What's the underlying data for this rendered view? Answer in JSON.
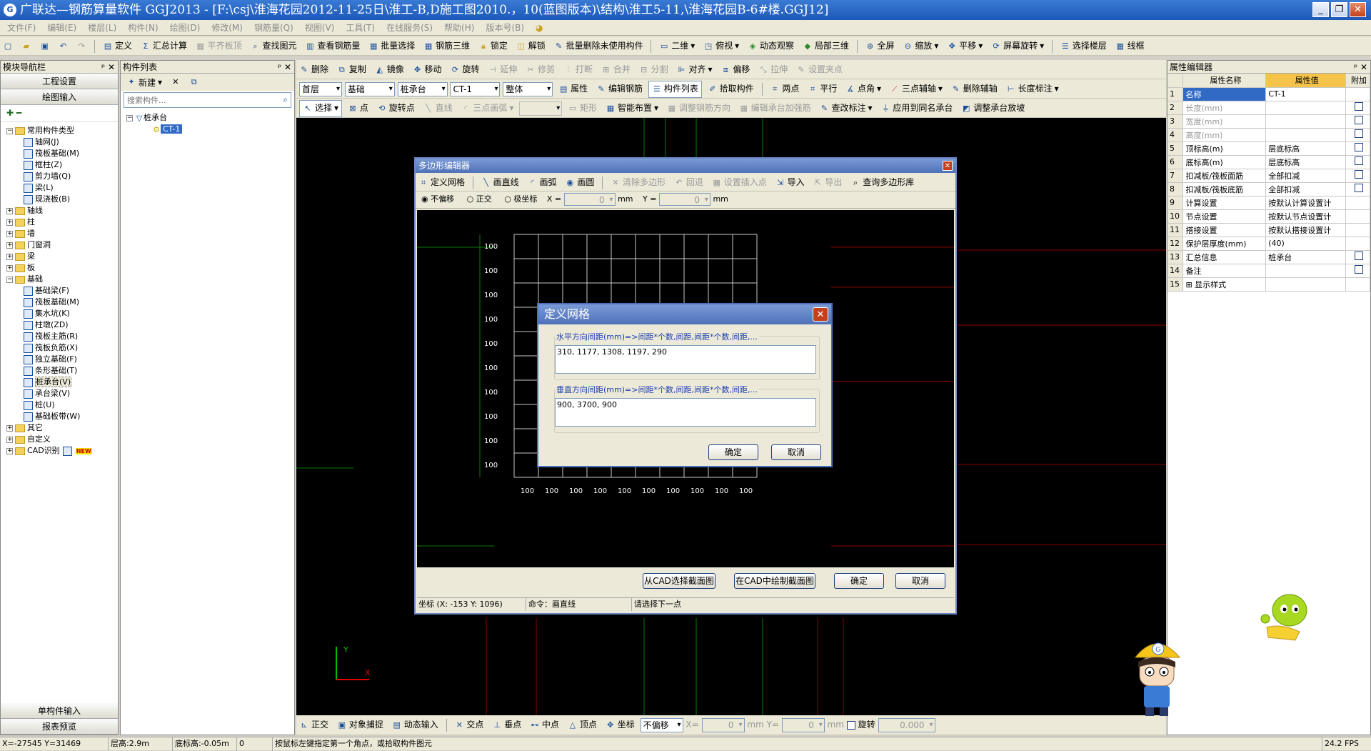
{
  "title": "广联达—钢筋算量软件 GGJ2013 - [F:\\csj\\淮海花园2012-11-25日\\淮工-B,D施工图2010.，10(蓝图版本)\\结构\\淮工5-11,\\淮海花园B-6#楼.GGJ12]",
  "menu": [
    "文件(F)",
    "编辑(E)",
    "楼层(L)",
    "构件(N)",
    "绘图(D)",
    "修改(M)",
    "钢筋量(Q)",
    "视图(V)",
    "工具(T)",
    "在线服务(S)",
    "帮助(H)",
    "版本号(B)"
  ],
  "toolbar1": {
    "define": "定义",
    "sum": "汇总计算",
    "flatten": "平齐板顶",
    "find": "查找图元",
    "view_rebar": "查看钢筋量",
    "batch_select": "批量选择",
    "rebar3d": "钢筋三维",
    "lock": "锁定",
    "unlock": "解锁",
    "batch_delete": "批量删除未使用构件",
    "view2d": "二维",
    "bird": "俯视",
    "dynamic": "动态观察",
    "local3d": "局部三维",
    "fullscreen": "全屏",
    "zoom": "缩放",
    "pan": "平移",
    "rotate": "屏幕旋转",
    "select_floor": "选择楼层",
    "wireframe": "线框"
  },
  "left_nav": {
    "header": "模块导航栏",
    "btn_project": "工程设置",
    "btn_draw": "绘图输入",
    "btn_single": "单构件输入",
    "btn_report": "报表预览"
  },
  "tree": [
    {
      "label": "常用构件类型",
      "level": 0,
      "type": "folder-open"
    },
    {
      "label": "轴网(J)",
      "level": 1
    },
    {
      "label": "筏板基础(M)",
      "level": 1
    },
    {
      "label": "框柱(Z)",
      "level": 1
    },
    {
      "label": "剪力墙(Q)",
      "level": 1
    },
    {
      "label": "梁(L)",
      "level": 1
    },
    {
      "label": "现浇板(B)",
      "level": 1
    },
    {
      "label": "轴线",
      "level": 0,
      "type": "folder"
    },
    {
      "label": "柱",
      "level": 0,
      "type": "folder"
    },
    {
      "label": "墙",
      "level": 0,
      "type": "folder"
    },
    {
      "label": "门窗洞",
      "level": 0,
      "type": "folder"
    },
    {
      "label": "梁",
      "level": 0,
      "type": "folder"
    },
    {
      "label": "板",
      "level": 0,
      "type": "folder"
    },
    {
      "label": "基础",
      "level": 0,
      "type": "folder-open"
    },
    {
      "label": "基础梁(F)",
      "level": 1
    },
    {
      "label": "筏板基础(M)",
      "level": 1
    },
    {
      "label": "集水坑(K)",
      "level": 1
    },
    {
      "label": "柱墩(ZD)",
      "level": 1
    },
    {
      "label": "筏板主筋(R)",
      "level": 1
    },
    {
      "label": "筏板负筋(X)",
      "level": 1
    },
    {
      "label": "独立基础(F)",
      "level": 1
    },
    {
      "label": "条形基础(T)",
      "level": 1
    },
    {
      "label": "桩承台(V)",
      "level": 1,
      "selected": true
    },
    {
      "label": "承台梁(V)",
      "level": 1
    },
    {
      "label": "桩(U)",
      "level": 1
    },
    {
      "label": "基础板带(W)",
      "level": 1
    },
    {
      "label": "其它",
      "level": 0,
      "type": "folder"
    },
    {
      "label": "自定义",
      "level": 0,
      "type": "folder"
    },
    {
      "label": "CAD识别",
      "level": 0,
      "type": "folder",
      "badge": "NEW"
    }
  ],
  "component_list": {
    "header": "构件列表",
    "new": "新建",
    "search_placeholder": "搜索构件...",
    "root": "桩承台",
    "item": "CT-1"
  },
  "edit_toolbar": {
    "delete": "删除",
    "copy": "复制",
    "mirror": "镜像",
    "move": "移动",
    "rotate": "旋转",
    "extend": "延伸",
    "trim": "修剪",
    "break": "打断",
    "merge": "合并",
    "split": "分割",
    "align": "对齐",
    "offset": "偏移",
    "stretch": "拉伸",
    "set_point": "设置夹点"
  },
  "selectors": {
    "floor": "首层",
    "category": "基础",
    "type": "桩承台",
    "name": "CT-1",
    "whole": "整体",
    "prop": "属性",
    "edit_rebar": "编辑钢筋",
    "comp_list": "构件列表",
    "pick": "拾取构件",
    "two_point": "两点",
    "parallel": "平行",
    "angle": "点角",
    "three_point": "三点辅轴",
    "del_aux": "删除辅轴",
    "length_mark": "长度标注"
  },
  "draw_toolbar": {
    "select": "选择",
    "point": "点",
    "rotate_point": "旋转点",
    "line": "直线",
    "arc": "三点画弧",
    "rect": "矩形",
    "smart": "智能布置",
    "adjust_dir": "调整钢筋方向",
    "edit_add": "编辑承台加强筋",
    "check": "查改标注",
    "apply_same": "应用到同名承台",
    "adjust_slope": "调整承台放坡"
  },
  "poly_editor": {
    "title": "多边形编辑器",
    "tools": {
      "grid": "定义网格",
      "line": "画直线",
      "arc": "画弧",
      "circle": "画圆",
      "clear": "清除多边形",
      "undo": "回退",
      "insert": "设置插入点",
      "import": "导入",
      "export": "导出",
      "library": "查询多边形库"
    },
    "offset": {
      "none": "不偏移",
      "ortho": "正交",
      "polar": "极坐标",
      "x_label": "X =",
      "x_val": "0",
      "y_label": "Y =",
      "y_val": "0",
      "unit": "mm"
    },
    "row_labels": [
      "100",
      "100",
      "100",
      "100",
      "100",
      "100",
      "100",
      "100",
      "100",
      "100"
    ],
    "col_labels": [
      "100",
      "100",
      "100",
      "100",
      "100",
      "100",
      "100",
      "100",
      "100",
      "100"
    ],
    "btn_cad_select": "从CAD选择截面图",
    "btn_cad_draw": "在CAD中绘制截面图",
    "ok": "确定",
    "cancel": "取消",
    "status_coord": "坐标 (X: -153 Y: 1096)",
    "status_cmd": "命令：画直线",
    "status_hint": "请选择下一点"
  },
  "grid_dialog": {
    "title": "定义网格",
    "h_label": "水平方向间距(mm)=>间距*个数,间距,间距*个数,间距,...",
    "h_value": "310, 1177, 1308, 1197, 290",
    "v_label": "垂直方向间距(mm)=>间距*个数,间距,间距*个数,间距,...",
    "v_value": "900, 3700, 900",
    "ok": "确定",
    "cancel": "取消"
  },
  "prop_editor": {
    "header": "属性编辑器",
    "cols": [
      "属性名称",
      "属性值",
      "附加"
    ],
    "rows": [
      {
        "n": "1",
        "name": "名称",
        "val": "CT-1",
        "chk": false,
        "hl": true
      },
      {
        "n": "2",
        "name": "长度(mm)",
        "val": "",
        "chk": true,
        "gray": true
      },
      {
        "n": "3",
        "name": "宽度(mm)",
        "val": "",
        "chk": true,
        "gray": true
      },
      {
        "n": "4",
        "name": "高度(mm)",
        "val": "",
        "chk": true,
        "gray": true
      },
      {
        "n": "5",
        "name": "顶标高(m)",
        "val": "层底标高",
        "chk": true
      },
      {
        "n": "6",
        "name": "底标高(m)",
        "val": "层底标高",
        "chk": true
      },
      {
        "n": "7",
        "name": "扣减板/筏板面筋",
        "val": "全部扣减",
        "chk": true
      },
      {
        "n": "8",
        "name": "扣减板/筏板底筋",
        "val": "全部扣减",
        "chk": true
      },
      {
        "n": "9",
        "name": "计算设置",
        "val": "按默认计算设置计",
        "chk": false
      },
      {
        "n": "10",
        "name": "节点设置",
        "val": "按默认节点设置计",
        "chk": false
      },
      {
        "n": "11",
        "name": "搭接设置",
        "val": "按默认搭接设置计",
        "chk": false
      },
      {
        "n": "12",
        "name": "保护层厚度(mm)",
        "val": "(40)",
        "chk": false
      },
      {
        "n": "13",
        "name": "汇总信息",
        "val": "桩承台",
        "chk": true
      },
      {
        "n": "14",
        "name": "备注",
        "val": "",
        "chk": true
      },
      {
        "n": "15",
        "name": "显示样式",
        "val": "",
        "chk": false,
        "expand": true
      }
    ]
  },
  "snap_bar": {
    "ortho": "正交",
    "snap": "对象捕捉",
    "dynamic": "动态输入",
    "intersect": "交点",
    "perp": "垂点",
    "mid": "中点",
    "vertex": "顶点",
    "coord": "坐标",
    "nooffset": "不偏移",
    "x": "X=",
    "xv": "0",
    "y": "Y=",
    "yv": "0",
    "mm": "mm",
    "rot": "旋转",
    "rotv": "0.000"
  },
  "status": {
    "xy": "X=-27545 Y=31469",
    "floor_h": "层高:2.9m",
    "bottom": "底标高:-0.05m",
    "zero": "0",
    "hint": "按鼠标左键指定第一个角点，或拾取构件图元",
    "fps": "24.2 FPS"
  }
}
